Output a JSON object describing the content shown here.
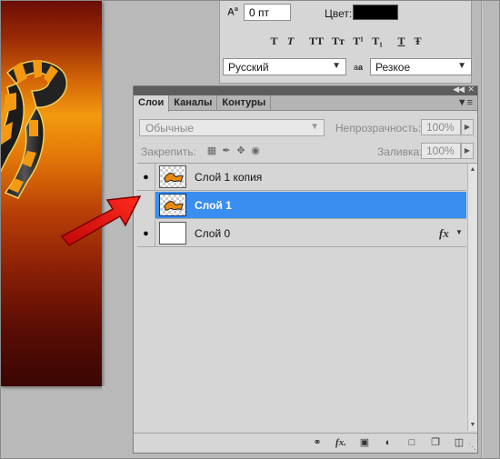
{
  "character": {
    "tracking_value": "0 пт",
    "color_label": "Цвет:",
    "color_value": "#000000",
    "style_buttons": [
      "T",
      "T",
      "TT",
      "Tт",
      "T¹",
      "T₁",
      "T",
      "Ŧ"
    ],
    "language": "Русский",
    "antialias": "Резкое",
    "antialias_icon": "a",
    "antialias_icon_small": "a",
    "tracking_icon": "A̲ª"
  },
  "layers_panel": {
    "tabs": [
      "Слои",
      "Каналы",
      "Контуры"
    ],
    "blend_mode": "Обычные",
    "opacity_label": "Непрозрачность:",
    "opacity_value": "100%",
    "lock_label": "Закрепить:",
    "fill_label": "Заливка:",
    "fill_value": "100%",
    "layers": [
      {
        "name": "Слой 1 копия",
        "visible": true,
        "selected": false,
        "has_fx": false
      },
      {
        "name": "Слой 1",
        "visible": false,
        "selected": true,
        "has_fx": false
      },
      {
        "name": "Слой 0",
        "visible": true,
        "selected": false,
        "has_fx": true
      }
    ],
    "fx_label": "fx",
    "bottom_icons": [
      "link-layers-icon",
      "add-style-icon",
      "add-mask-icon",
      "adjustment-layer-icon",
      "new-group-icon",
      "new-layer-icon",
      "delete-layer-icon"
    ]
  },
  "colors": {
    "selection": "#3a8eef",
    "panel_bg": "#d6d6d6",
    "arrow": "#e01010"
  }
}
